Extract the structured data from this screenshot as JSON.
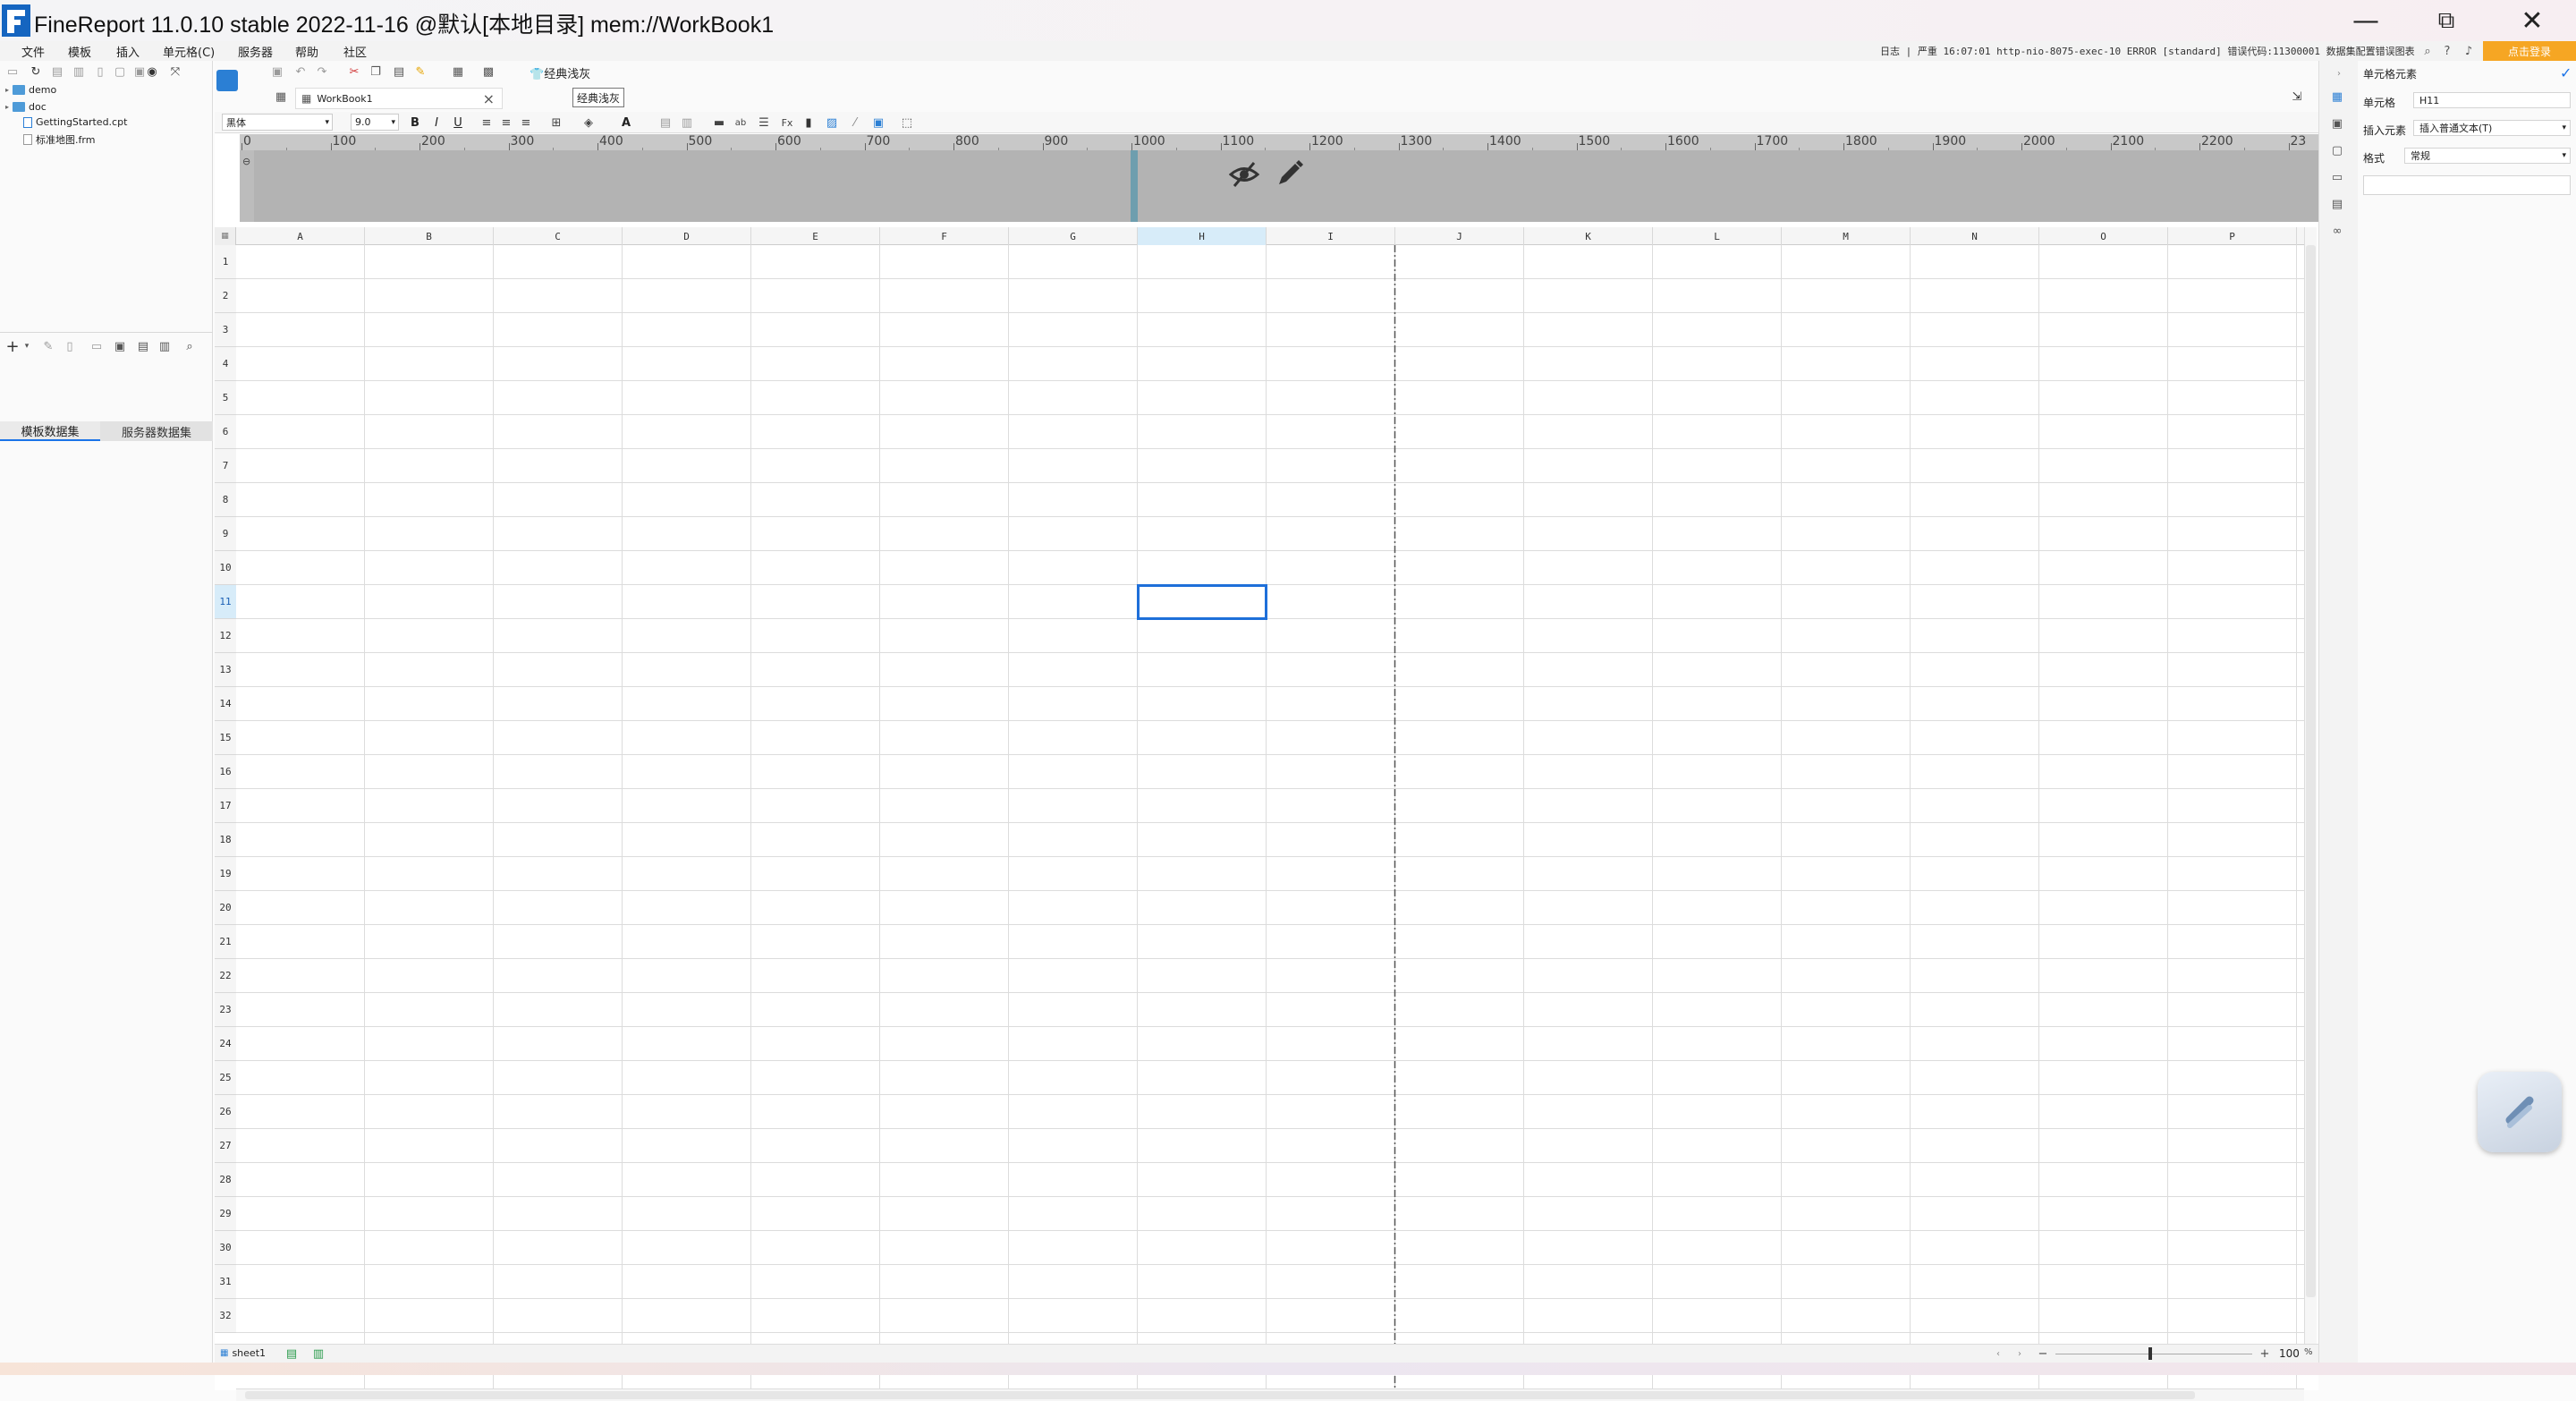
{
  "window": {
    "title": "FineReport 11.0.10 stable 2022-11-16 @默认[本地目录]    mem://WorkBook1",
    "minimize_glyph": "—",
    "maximize_glyph": "⧉",
    "close_glyph": "✕"
  },
  "menu": {
    "items": [
      "文件",
      "模板",
      "插入",
      "单元格(C)",
      "服务器",
      "帮助",
      "社区"
    ],
    "log_status": "日志 | 严重 16:07:01 http-nio-8075-exec-10 ERROR [standard] 错误代码:11300001 数据集配置错误图表",
    "login_label": "点击登录"
  },
  "left_panel": {
    "tree": [
      {
        "label": "demo",
        "type": "folder"
      },
      {
        "label": "doc",
        "type": "folder"
      },
      {
        "label": "GettingStarted.cpt",
        "type": "file"
      },
      {
        "label": "标准地图.frm",
        "type": "file"
      }
    ],
    "tabs": [
      "模板数据集",
      "服务器数据集"
    ]
  },
  "doc": {
    "tab_label": "WorkBook1",
    "close_glyph": "×",
    "style_button": "经典浅灰",
    "style_tooltip": "经典浅灰"
  },
  "format_bar": {
    "font_name": "黑体",
    "font_size": "9.0"
  },
  "ruler": {
    "ticks": [
      "0",
      "100",
      "200",
      "300",
      "400",
      "500",
      "600",
      "700",
      "800",
      "900",
      "1000",
      "1100",
      "1200",
      "1300",
      "1400",
      "1500",
      "1600",
      "1700",
      "1800",
      "1900",
      "2000",
      "2100",
      "2200",
      "23"
    ]
  },
  "sheet": {
    "columns": [
      "A",
      "B",
      "C",
      "D",
      "E",
      "F",
      "G",
      "H",
      "I",
      "J",
      "K",
      "L",
      "M",
      "N",
      "O",
      "P"
    ],
    "rows": [
      "1",
      "2",
      "3",
      "4",
      "5",
      "6",
      "7",
      "8",
      "9",
      "10",
      "11",
      "12",
      "13",
      "14",
      "15",
      "16",
      "17",
      "18",
      "19",
      "20",
      "21",
      "22",
      "23",
      "24",
      "25",
      "26",
      "27",
      "28",
      "29",
      "30",
      "31",
      "32"
    ],
    "selected_cell": "H11",
    "selected_col": "H",
    "selected_row": "11",
    "tab_label": "sheet1",
    "zoom": "100"
  },
  "right_panel": {
    "title": "单元格元素",
    "cell_label": "单元格",
    "cell_value": "H11",
    "insert_label": "插入元素",
    "insert_value": "插入普通文本(T)",
    "format_label": "格式",
    "format_value": "常规"
  },
  "colors": {
    "accent": "#1a73e8",
    "login_orange": "#f6a623",
    "band_gray": "#b3b3b3",
    "selection_blue": "#1e6fd9"
  }
}
